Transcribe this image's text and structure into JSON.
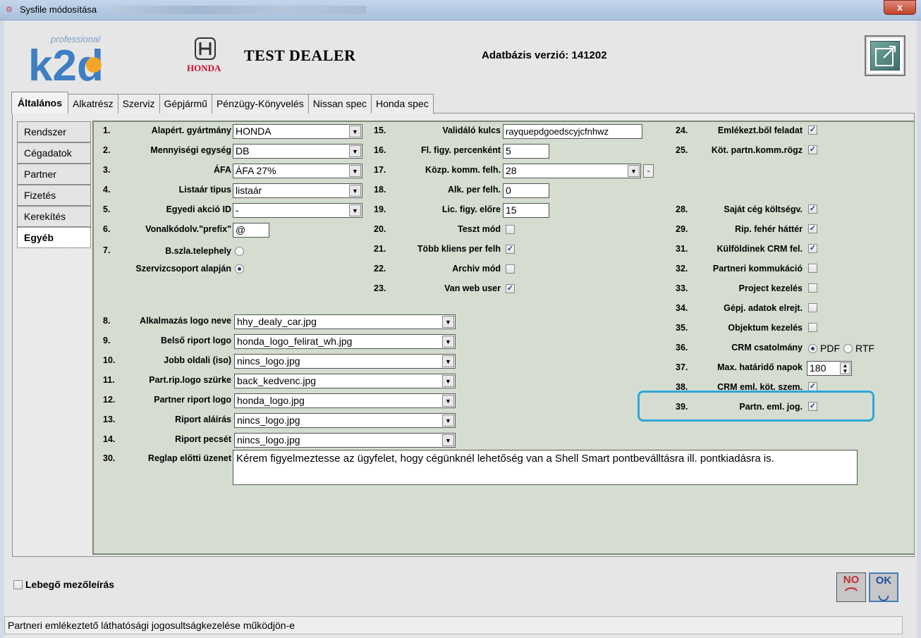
{
  "window": {
    "title": "Sysfile módosítása",
    "close_label": "x"
  },
  "header": {
    "logo_small": "professional",
    "logo_text": "k2d",
    "honda_text": "HONDA",
    "dealer": "TEST DEALER",
    "db_version": "Adatbázis verzió: 141202"
  },
  "tabs": [
    "Általános",
    "Alkatrész",
    "Szerviz",
    "Gépjármű",
    "Pénzügy-Könyvelés",
    "Nissan spec",
    "Honda spec"
  ],
  "side_tabs": [
    "Rendszer",
    "Cégadatok",
    "Partner",
    "Fizetés",
    "Kerekítés",
    "Egyéb"
  ],
  "col1": [
    {
      "num": "1.",
      "label": "Alapért. gyártmány",
      "value": "HONDA"
    },
    {
      "num": "2.",
      "label": "Mennyiségi egység",
      "value": "DB"
    },
    {
      "num": "3.",
      "label": "ÁFA",
      "value": "ÁFA 27%"
    },
    {
      "num": "4.",
      "label": "Listaár tipus",
      "value": "listaár"
    },
    {
      "num": "5.",
      "label": "Egyedi akció ID",
      "value": "-"
    },
    {
      "num": "6.",
      "label": "Vonalkódolv.\"prefix\"",
      "value": "@"
    },
    {
      "num": "7.",
      "label": "B.szla.telephely",
      "label2": "Szervizcsoport alapján"
    }
  ],
  "col1b": [
    {
      "num": "8.",
      "label": "Alkalmazás logo neve",
      "value": "hhy_dealy_car.jpg"
    },
    {
      "num": "9.",
      "label": "Belső riport logo",
      "value": "honda_logo_felirat_wh.jpg"
    },
    {
      "num": "10.",
      "label": "Jobb oldali (iso)",
      "value": "nincs_logo.jpg"
    },
    {
      "num": "11.",
      "label": "Part.rip.logo szürke",
      "value": "back_kedvenc.jpg"
    },
    {
      "num": "12.",
      "label": "Partner riport logo",
      "value": "honda_logo.jpg"
    },
    {
      "num": "13.",
      "label": "Riport aláírás",
      "value": "nincs_logo.jpg"
    },
    {
      "num": "14.",
      "label": "Riport pecsét",
      "value": "nincs_logo.jpg"
    },
    {
      "num": "30.",
      "label": "Reglap előtti üzenet",
      "value": "Kérem figyelmeztesse az ügyfelet, hogy cégünknél lehetőség van a Shell Smart pontbeválltásra ill. pontkiadásra is."
    }
  ],
  "col2": [
    {
      "num": "15.",
      "label": "Validáló kulcs",
      "value": "rayquepdgoedscyjcfnhwz"
    },
    {
      "num": "16.",
      "label": "Fl. figy. percenként",
      "value": "5"
    },
    {
      "num": "17.",
      "label": "Közp. komm. felh.",
      "value": "28",
      "minus": "-"
    },
    {
      "num": "18.",
      "label": "Alk. per felh.",
      "value": "0"
    },
    {
      "num": "19.",
      "label": "Lic. figy. előre",
      "value": "15"
    },
    {
      "num": "20.",
      "label": "Teszt mód",
      "checked": false
    },
    {
      "num": "21.",
      "label": "Több kliens per felh",
      "checked": true
    },
    {
      "num": "22.",
      "label": "Archiv mód",
      "checked": false
    },
    {
      "num": "23.",
      "label": "Van web user",
      "checked": true
    }
  ],
  "col3": [
    {
      "num": "24.",
      "label": "Emlékezt.ből feladat",
      "checked": true
    },
    {
      "num": "25.",
      "label": "Köt. partn.komm.rögz",
      "checked": true
    },
    {
      "num": "28.",
      "label": "Saját cég költségv.",
      "checked": true
    },
    {
      "num": "29.",
      "label": "Rip. fehér háttér",
      "checked": true
    },
    {
      "num": "31.",
      "label": "Külföldinek CRM fel.",
      "checked": true
    },
    {
      "num": "32.",
      "label": "Partneri kommukáció",
      "checked": false
    },
    {
      "num": "33.",
      "label": "Project kezelés",
      "checked": false
    },
    {
      "num": "34.",
      "label": "Gépj. adatok elrejt.",
      "checked": false
    },
    {
      "num": "35.",
      "label": "Objektum kezelés",
      "checked": false
    },
    {
      "num": "36.",
      "label": "CRM csatolmány",
      "opt1": "PDF",
      "opt2": "RTF"
    },
    {
      "num": "37.",
      "label": "Max. határidő napok",
      "value": "180"
    },
    {
      "num": "38.",
      "label": "CRM eml. köt. szem.",
      "checked": true
    },
    {
      "num": "39.",
      "label": "Partn. eml. jog.",
      "checked": true
    }
  ],
  "footer": {
    "floating_label": "Lebegő mezőleírás",
    "no_label": "NO",
    "ok_label": "OK",
    "status": "Partneri emlékeztető láthatósági jogosultságkezelése működjön-e"
  },
  "colors": {
    "panel": "#d4ddd0",
    "highlight": "#30a6d8"
  }
}
